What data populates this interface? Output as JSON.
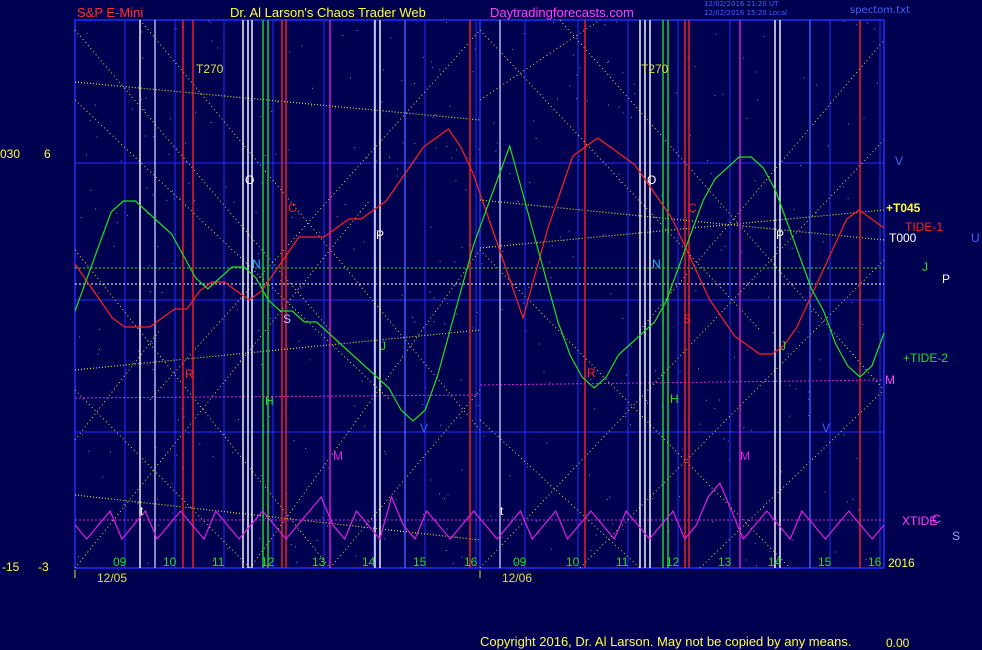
{
  "header": {
    "symbol": "S&P E-Mini",
    "author": "Dr. Al Larson's Chaos Trader Web",
    "site": "Daytradingforecasts.com",
    "timestamp1": "12/02/2016 21:20 UT",
    "timestamp2": "12/02/2016 15:20 Local",
    "file": "spectom.txt"
  },
  "footer": {
    "copyright": "Copyright 2016, Dr. Al Larson. May not be copied by any means.",
    "corner": "0.00"
  },
  "left_scale": {
    "top_a": "030",
    "top_b": "6",
    "bottom_a": "-15",
    "bottom_b": "-3"
  },
  "right_labels": {
    "v": "V",
    "t045": "+T045",
    "tide1": "TIDE-1",
    "t000": "T000",
    "u": "U",
    "j": "J",
    "p": "P",
    "tide2": "+TIDE-2",
    "m": "M",
    "xtide": "XTIDE",
    "c": "C",
    "s": "S",
    "year": "2016"
  },
  "colors": {
    "background": "#000050",
    "grid": "#2030ff",
    "yellow": "#e0e040",
    "red": "#ff2020",
    "green": "#20e020",
    "magenta": "#e020e0",
    "white": "#f0f0f0",
    "cyan": "#20c0ff"
  },
  "chart_data": {
    "type": "line",
    "title": "S&P E-Mini",
    "days": [
      "12/05",
      "12/06"
    ],
    "hour_ticks": [
      "09",
      "10",
      "11",
      "12",
      "13",
      "14",
      "15",
      "16",
      "09",
      "10",
      "11",
      "12",
      "13",
      "14",
      "15",
      "16"
    ],
    "top_labels": [
      "T270",
      "T270"
    ],
    "planet_letters_day1": [
      "O",
      "N",
      "C",
      "S",
      "P",
      "R",
      "H",
      "J",
      "M",
      "V",
      "t"
    ],
    "planet_letters_day2": [
      "O",
      "N",
      "C",
      "S",
      "P",
      "R",
      "H",
      "J",
      "M",
      "V",
      "t"
    ],
    "series": [
      {
        "name": "TIDE-1",
        "color": "#ff2020",
        "role": "red",
        "values": [
          4,
          2,
          0,
          -2,
          -3,
          -3,
          -3,
          -2,
          -1,
          -1,
          1,
          2,
          2,
          1,
          0,
          1,
          3,
          5,
          7,
          7,
          7,
          8,
          9,
          9,
          10,
          11,
          13,
          15,
          17,
          18,
          19,
          17,
          14,
          10,
          6,
          2,
          -2,
          3,
          8,
          12,
          16,
          17,
          18,
          17,
          16,
          15,
          13,
          11,
          9,
          6,
          3,
          0,
          -2,
          -4,
          -5,
          -6,
          -6,
          -5,
          -3,
          0,
          3,
          6,
          9,
          10,
          9,
          8
        ]
      },
      {
        "name": "TIDE-2",
        "color": "#20e020",
        "role": "green",
        "values": [
          -1,
          2,
          5,
          8,
          9,
          9,
          8,
          7,
          6,
          4,
          2,
          1,
          2,
          3,
          3,
          2,
          0,
          -1,
          -1,
          -2,
          -2,
          -3,
          -4,
          -5,
          -6,
          -7,
          -8,
          -10,
          -11,
          -10,
          -7,
          -3,
          1,
          5,
          8,
          11,
          14,
          10,
          6,
          2,
          -2,
          -5,
          -7,
          -8,
          -7,
          -5,
          -4,
          -3,
          -2,
          0,
          3,
          6,
          9,
          11,
          12,
          13,
          13,
          12,
          10,
          7,
          4,
          1,
          -1,
          -4,
          -6,
          -7,
          -6,
          -3
        ]
      },
      {
        "name": "XTIDE",
        "color": "#e020e0",
        "role": "magenta",
        "values": [
          0,
          -1,
          0,
          1,
          -1,
          0,
          1,
          -1,
          0,
          1,
          0,
          -1,
          1,
          0,
          -1,
          0,
          1,
          0,
          -1,
          0,
          1,
          2,
          0,
          -1,
          1,
          0,
          -1,
          2,
          0,
          -1,
          1,
          0,
          -1,
          0,
          1,
          0,
          -1,
          0,
          1,
          -1,
          0,
          1,
          -1,
          0,
          1,
          0,
          -1,
          1,
          0,
          -1,
          0,
          1,
          -1,
          0,
          2,
          3,
          1,
          -1,
          0,
          1,
          0,
          -1,
          1,
          0,
          -1,
          0,
          1,
          0,
          -1,
          0
        ]
      }
    ]
  }
}
